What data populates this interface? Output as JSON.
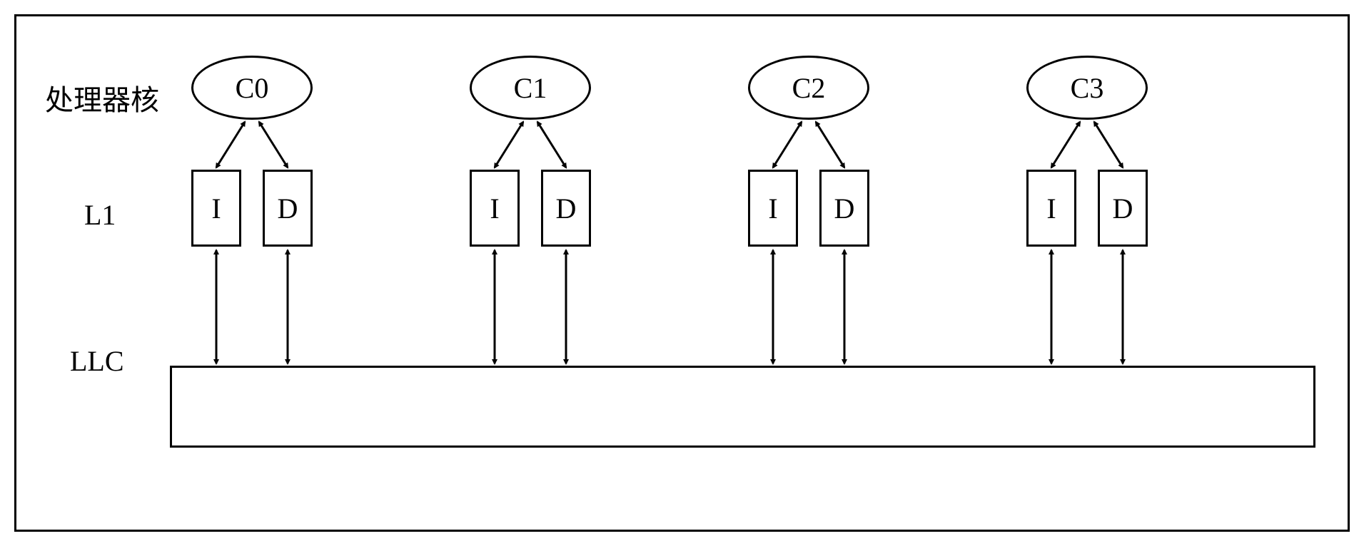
{
  "labels": {
    "processor_core": "处理器核",
    "l1": "L1",
    "llc": "LLC"
  },
  "cores": [
    {
      "name": "C0"
    },
    {
      "name": "C1"
    },
    {
      "name": "C2"
    },
    {
      "name": "C3"
    }
  ],
  "cache_types": {
    "instruction": "I",
    "data": "D"
  }
}
